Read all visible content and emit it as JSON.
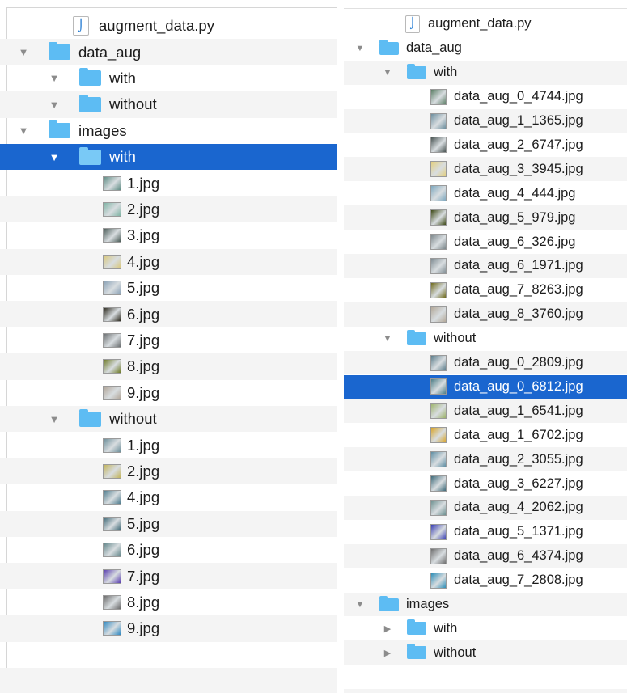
{
  "left_pane": {
    "rows": [
      {
        "label": "augment_data.py",
        "icon": "python-file-icon",
        "tri": "none",
        "indent": 1,
        "alt": false,
        "selected": false
      },
      {
        "label": "data_aug",
        "icon": "folder-icon",
        "tri": "down",
        "indent": 0,
        "alt": true,
        "selected": false
      },
      {
        "label": "with",
        "icon": "folder-icon",
        "tri": "down",
        "indent": 1,
        "alt": false,
        "selected": false
      },
      {
        "label": "without",
        "icon": "folder-icon",
        "tri": "down",
        "indent": 1,
        "alt": true,
        "selected": false
      },
      {
        "label": "images",
        "icon": "folder-icon",
        "tri": "down",
        "indent": 0,
        "alt": false,
        "selected": false
      },
      {
        "label": "with",
        "icon": "folder-icon",
        "tri": "down",
        "indent": 1,
        "alt": false,
        "selected": true
      },
      {
        "label": "1.jpg",
        "icon": "image-thumbnail-icon",
        "tri": "none",
        "indent": 2,
        "alt": false,
        "selected": false,
        "thumb": "#5f8c84"
      },
      {
        "label": "2.jpg",
        "icon": "image-thumbnail-icon",
        "tri": "none",
        "indent": 2,
        "alt": true,
        "selected": false,
        "thumb": "#7fb3a4"
      },
      {
        "label": "3.jpg",
        "icon": "image-thumbnail-icon",
        "tri": "none",
        "indent": 2,
        "alt": false,
        "selected": false,
        "thumb": "#4b5c58"
      },
      {
        "label": "4.jpg",
        "icon": "image-thumbnail-icon",
        "tri": "none",
        "indent": 2,
        "alt": true,
        "selected": false,
        "thumb": "#d9c77a"
      },
      {
        "label": "5.jpg",
        "icon": "image-thumbnail-icon",
        "tri": "none",
        "indent": 2,
        "alt": false,
        "selected": false,
        "thumb": "#8aa1b6"
      },
      {
        "label": "6.jpg",
        "icon": "image-thumbnail-icon",
        "tri": "none",
        "indent": 2,
        "alt": true,
        "selected": false,
        "thumb": "#2d2a1f"
      },
      {
        "label": "7.jpg",
        "icon": "image-thumbnail-icon",
        "tri": "none",
        "indent": 2,
        "alt": false,
        "selected": false,
        "thumb": "#6b6f71"
      },
      {
        "label": "8.jpg",
        "icon": "image-thumbnail-icon",
        "tri": "none",
        "indent": 2,
        "alt": true,
        "selected": false,
        "thumb": "#6e7a28"
      },
      {
        "label": "9.jpg",
        "icon": "image-thumbnail-icon",
        "tri": "none",
        "indent": 2,
        "alt": false,
        "selected": false,
        "thumb": "#b0a497"
      },
      {
        "label": "without",
        "icon": "folder-icon",
        "tri": "down",
        "indent": 1,
        "alt": true,
        "selected": false
      },
      {
        "label": "1.jpg",
        "icon": "image-thumbnail-icon",
        "tri": "none",
        "indent": 2,
        "alt": false,
        "selected": false,
        "thumb": "#6e8f9a"
      },
      {
        "label": "2.jpg",
        "icon": "image-thumbnail-icon",
        "tri": "none",
        "indent": 2,
        "alt": true,
        "selected": false,
        "thumb": "#c2b45b"
      },
      {
        "label": "4.jpg",
        "icon": "image-thumbnail-icon",
        "tri": "none",
        "indent": 2,
        "alt": false,
        "selected": false,
        "thumb": "#4f7c8e"
      },
      {
        "label": "5.jpg",
        "icon": "image-thumbnail-icon",
        "tri": "none",
        "indent": 2,
        "alt": true,
        "selected": false,
        "thumb": "#3d6775"
      },
      {
        "label": "6.jpg",
        "icon": "image-thumbnail-icon",
        "tri": "none",
        "indent": 2,
        "alt": false,
        "selected": false,
        "thumb": "#62868a"
      },
      {
        "label": "7.jpg",
        "icon": "image-thumbnail-icon",
        "tri": "none",
        "indent": 2,
        "alt": true,
        "selected": false,
        "thumb": "#5a3fb0"
      },
      {
        "label": "8.jpg",
        "icon": "image-thumbnail-icon",
        "tri": "none",
        "indent": 2,
        "alt": false,
        "selected": false,
        "thumb": "#6a6a6a"
      },
      {
        "label": "9.jpg",
        "icon": "image-thumbnail-icon",
        "tri": "none",
        "indent": 2,
        "alt": true,
        "selected": false,
        "thumb": "#2f89c2"
      },
      {
        "label": "",
        "icon": "",
        "tri": "none",
        "indent": 0,
        "alt": false,
        "selected": false
      },
      {
        "label": "",
        "icon": "",
        "tri": "none",
        "indent": 0,
        "alt": true,
        "selected": false
      }
    ]
  },
  "right_pane": {
    "rows": [
      {
        "label": "augment_data.py",
        "icon": "python-file-icon",
        "tri": "none",
        "indent": 1,
        "alt": false,
        "selected": false
      },
      {
        "label": "data_aug",
        "icon": "folder-icon",
        "tri": "down",
        "indent": 0,
        "alt": false,
        "selected": false
      },
      {
        "label": "with",
        "icon": "folder-icon",
        "tri": "down",
        "indent": 1,
        "alt": true,
        "selected": false
      },
      {
        "label": "data_aug_0_4744.jpg",
        "icon": "image-thumbnail-icon",
        "tri": "none",
        "indent": 2,
        "alt": false,
        "selected": false,
        "thumb": "#5c7e66"
      },
      {
        "label": "data_aug_1_1365.jpg",
        "icon": "image-thumbnail-icon",
        "tri": "none",
        "indent": 2,
        "alt": true,
        "selected": false,
        "thumb": "#6d8e9e"
      },
      {
        "label": "data_aug_2_6747.jpg",
        "icon": "image-thumbnail-icon",
        "tri": "none",
        "indent": 2,
        "alt": false,
        "selected": false,
        "thumb": "#4a5554"
      },
      {
        "label": "data_aug_3_3945.jpg",
        "icon": "image-thumbnail-icon",
        "tri": "none",
        "indent": 2,
        "alt": true,
        "selected": false,
        "thumb": "#e3cf7f"
      },
      {
        "label": "data_aug_4_444.jpg",
        "icon": "image-thumbnail-icon",
        "tri": "none",
        "indent": 2,
        "alt": false,
        "selected": false,
        "thumb": "#7ea8bf"
      },
      {
        "label": "data_aug_5_979.jpg",
        "icon": "image-thumbnail-icon",
        "tri": "none",
        "indent": 2,
        "alt": true,
        "selected": false,
        "thumb": "#3e4a17"
      },
      {
        "label": "data_aug_6_326.jpg",
        "icon": "image-thumbnail-icon",
        "tri": "none",
        "indent": 2,
        "alt": false,
        "selected": false,
        "thumb": "#7b868a"
      },
      {
        "label": "data_aug_6_1971.jpg",
        "icon": "image-thumbnail-icon",
        "tri": "none",
        "indent": 2,
        "alt": true,
        "selected": false,
        "thumb": "#7f8c92"
      },
      {
        "label": "data_aug_7_8263.jpg",
        "icon": "image-thumbnail-icon",
        "tri": "none",
        "indent": 2,
        "alt": false,
        "selected": false,
        "thumb": "#6f6a1d"
      },
      {
        "label": "data_aug_8_3760.jpg",
        "icon": "image-thumbnail-icon",
        "tri": "none",
        "indent": 2,
        "alt": true,
        "selected": false,
        "thumb": "#b4a99a"
      },
      {
        "label": "without",
        "icon": "folder-icon",
        "tri": "down",
        "indent": 1,
        "alt": false,
        "selected": false
      },
      {
        "label": "data_aug_0_2809.jpg",
        "icon": "image-thumbnail-icon",
        "tri": "none",
        "indent": 2,
        "alt": true,
        "selected": false,
        "thumb": "#5b7c8a"
      },
      {
        "label": "data_aug_0_6812.jpg",
        "icon": "image-thumbnail-icon",
        "tri": "none",
        "indent": 2,
        "alt": false,
        "selected": true,
        "thumb": "#4f7f88"
      },
      {
        "label": "data_aug_1_6541.jpg",
        "icon": "image-thumbnail-icon",
        "tri": "none",
        "indent": 2,
        "alt": true,
        "selected": false,
        "thumb": "#9db36a"
      },
      {
        "label": "data_aug_1_6702.jpg",
        "icon": "image-thumbnail-icon",
        "tri": "none",
        "indent": 2,
        "alt": false,
        "selected": false,
        "thumb": "#d9a52a"
      },
      {
        "label": "data_aug_2_3055.jpg",
        "icon": "image-thumbnail-icon",
        "tri": "none",
        "indent": 2,
        "alt": true,
        "selected": false,
        "thumb": "#5f8ea3"
      },
      {
        "label": "data_aug_3_6227.jpg",
        "icon": "image-thumbnail-icon",
        "tri": "none",
        "indent": 2,
        "alt": false,
        "selected": false,
        "thumb": "#3f6b7a"
      },
      {
        "label": "data_aug_4_2062.jpg",
        "icon": "image-thumbnail-icon",
        "tri": "none",
        "indent": 2,
        "alt": true,
        "selected": false,
        "thumb": "#6d9090"
      },
      {
        "label": "data_aug_5_1371.jpg",
        "icon": "image-thumbnail-icon",
        "tri": "none",
        "indent": 2,
        "alt": false,
        "selected": false,
        "thumb": "#3a3fb4"
      },
      {
        "label": "data_aug_6_4374.jpg",
        "icon": "image-thumbnail-icon",
        "tri": "none",
        "indent": 2,
        "alt": true,
        "selected": false,
        "thumb": "#6f6f6f"
      },
      {
        "label": "data_aug_7_2808.jpg",
        "icon": "image-thumbnail-icon",
        "tri": "none",
        "indent": 2,
        "alt": false,
        "selected": false,
        "thumb": "#2f8fb8"
      },
      {
        "label": "images",
        "icon": "folder-icon",
        "tri": "down",
        "indent": 0,
        "alt": true,
        "selected": false
      },
      {
        "label": "with",
        "icon": "folder-icon",
        "tri": "right",
        "indent": 1,
        "alt": false,
        "selected": false
      },
      {
        "label": "without",
        "icon": "folder-icon",
        "tri": "right",
        "indent": 1,
        "alt": true,
        "selected": false
      },
      {
        "label": "",
        "icon": "",
        "tri": "none",
        "indent": 0,
        "alt": false,
        "selected": false
      },
      {
        "label": "",
        "icon": "",
        "tri": "none",
        "indent": 0,
        "alt": true,
        "selected": false
      }
    ]
  }
}
